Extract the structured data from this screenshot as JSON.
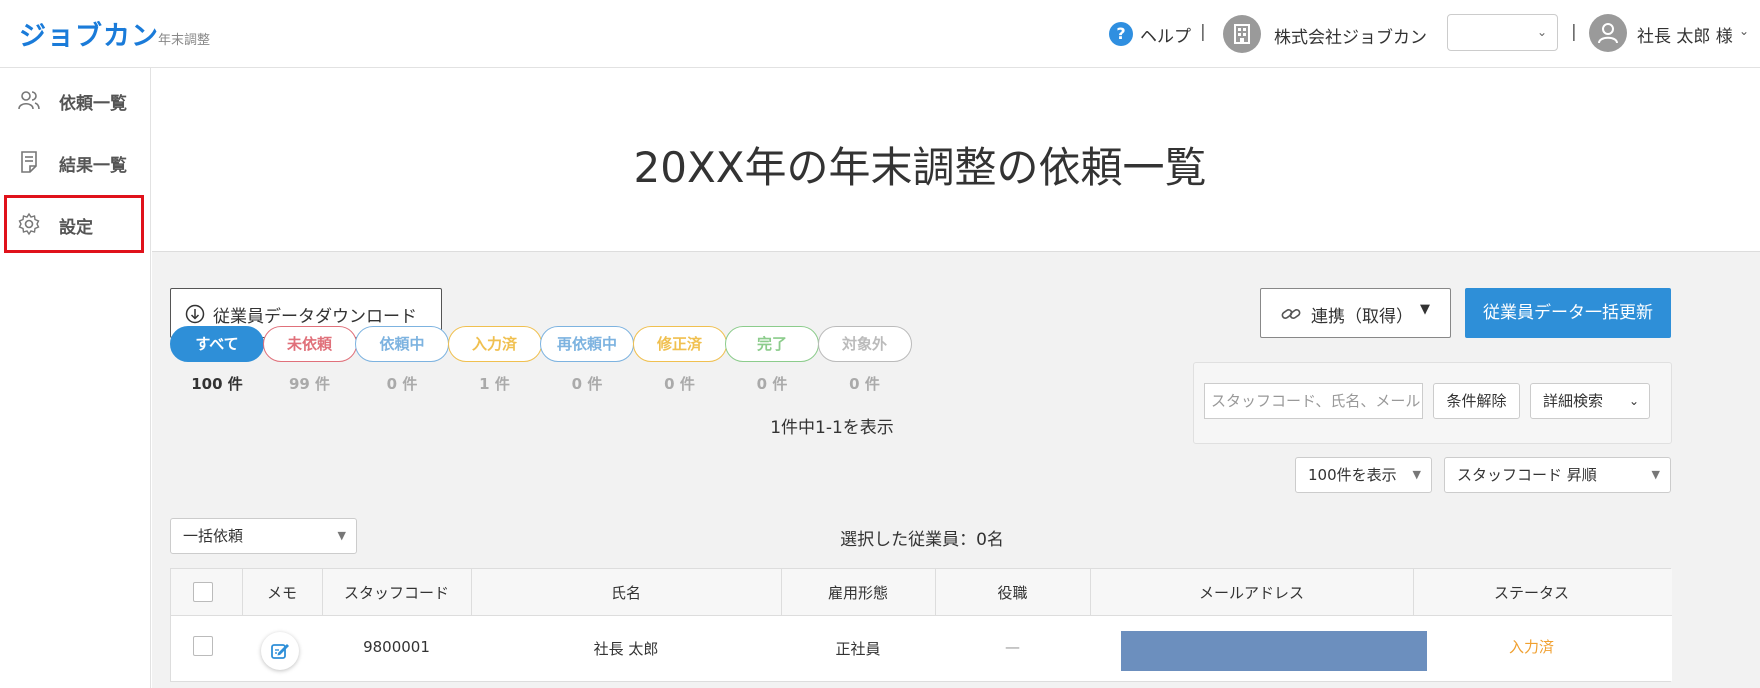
{
  "app": {
    "logo": "ジョブカン",
    "logo_sub": "年末調整"
  },
  "header": {
    "help_label": "ヘルプ",
    "separator": "|",
    "company_name": "株式会社ジョブカン",
    "company_select_value": "",
    "user_name": "社長 太郎 様"
  },
  "sidebar": {
    "items": [
      {
        "label": "依頼一覧",
        "icon": "users-icon"
      },
      {
        "label": "結果一覧",
        "icon": "document-icon"
      },
      {
        "label": "設定",
        "icon": "gear-icon",
        "highlighted": true
      }
    ]
  },
  "page": {
    "title": "20XX年の年末調整の依頼一覧"
  },
  "toolbar": {
    "download_label": "従業員データダウンロード",
    "link_label": "連携（取得）",
    "bulk_update_label": "従業員データ一括更新"
  },
  "filters": [
    {
      "label": "すべて",
      "count": "100 件",
      "color": "#2e8fd8",
      "active": true
    },
    {
      "label": "未依頼",
      "count": "99 件",
      "color": "#e0707a"
    },
    {
      "label": "依頼中",
      "count": "0 件",
      "color": "#7db3e0"
    },
    {
      "label": "入力済",
      "count": "1 件",
      "color": "#f0c050"
    },
    {
      "label": "再依頼中",
      "count": "0 件",
      "color": "#7db3e0"
    },
    {
      "label": "修正済",
      "count": "0 件",
      "color": "#f0c050"
    },
    {
      "label": "完了",
      "count": "0 件",
      "color": "#8ccc8c"
    },
    {
      "label": "対象外",
      "count": "0 件",
      "color": "#bbbbbb"
    }
  ],
  "search": {
    "placeholder": "スタッフコード、氏名、メール",
    "clear_label": "条件解除",
    "advanced_label": "詳細検索"
  },
  "listing": {
    "display_text": "1件中1-1を表示",
    "per_page": "100件を表示",
    "sort": "スタッフコード 昇順",
    "bulk_action": "一括依頼",
    "selected_text": "選択した従業員：0名"
  },
  "table": {
    "headers": [
      "メモ",
      "スタッフコード",
      "氏名",
      "雇用形態",
      "役職",
      "メールアドレス",
      "ステータス"
    ],
    "rows": [
      {
        "staff_code": "9800001",
        "name": "社長 太郎",
        "employment": "正社員",
        "position": "—",
        "email": "",
        "status": "入力済"
      }
    ]
  },
  "colors": {
    "accent": "#2e8fd8",
    "status_input_done": "#f0a030",
    "highlight": "#e0121b"
  }
}
